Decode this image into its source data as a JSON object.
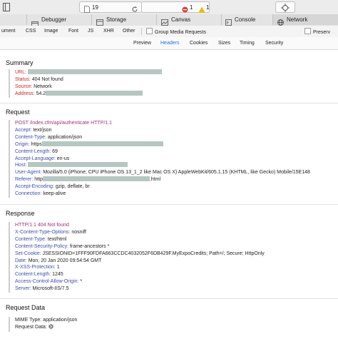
{
  "window": {
    "tab_count": "19",
    "error_count": "1",
    "warning_count": "1"
  },
  "panel_tabs": [
    {
      "label": "Debugger"
    },
    {
      "label": "Storage"
    },
    {
      "label": "Canvas"
    },
    {
      "label": "Console"
    },
    {
      "label": "Network"
    }
  ],
  "filter_bar": {
    "types": [
      "ument",
      "CSS",
      "Image",
      "Font",
      "JS",
      "XHR",
      "Other"
    ],
    "group_media_label": "Group Media Requests",
    "preserve_label": "Preserv"
  },
  "detail_tabs": [
    "Preview",
    "Headers",
    "Cookies",
    "Sizes",
    "Timing",
    "Security"
  ],
  "active_detail_tab": "Headers",
  "summary": {
    "title": "Summary",
    "url_key": "URL:",
    "status_key": "Status:",
    "status_val": "404 Not found",
    "source_key": "Source:",
    "source_val": "Network",
    "address_key": "Address:",
    "address_val": "54.2"
  },
  "request": {
    "title": "Request",
    "request_line": "POST /index.cfm/api/authenticate HTTP/1.1",
    "headers": [
      {
        "k": "Accept:",
        "v": "text/json"
      },
      {
        "k": "Content-Type:",
        "v": "application/json"
      },
      {
        "k": "Origin:",
        "v": "https"
      },
      {
        "k": "Content-Length:",
        "v": "69"
      },
      {
        "k": "Accept-Language:",
        "v": "en-us"
      },
      {
        "k": "Host:",
        "v": ""
      },
      {
        "k": "User-Agent:",
        "v": "Mozilla/5.0 (iPhone; CPU iPhone OS 13_1_2 like Mac OS X) AppleWebKit/605.1.15 (KHTML, like Gecko) Mobile/15E148"
      },
      {
        "k": "Referer:",
        "v": "http",
        "tail": ".html"
      },
      {
        "k": "Accept-Encoding:",
        "v": "gzip, deflate, br"
      },
      {
        "k": "Connection:",
        "v": "keep-alive"
      }
    ]
  },
  "response": {
    "title": "Response",
    "status_line": "HTTP/1.1 404 Not found",
    "headers": [
      {
        "k": "X-Content-Type-Options:",
        "v": "nosniff"
      },
      {
        "k": "Content-Type:",
        "v": "text/html"
      },
      {
        "k": "Content-Security-Policy:",
        "v": "frame-ancestors *"
      },
      {
        "k": "Set-Cookie:",
        "v": "JSESSIONID=1FFF90FDFA663CCDC4032052F6DB429F.MyExpoCredits; Path=/; Secure; HttpOnly"
      },
      {
        "k": "Date:",
        "v": "Mon, 20 Jan 2020 09:54:54 GMT"
      },
      {
        "k": "X-XSS-Protection:",
        "v": "1"
      },
      {
        "k": "Content-Length:",
        "v": "1245"
      },
      {
        "k": "Access-Control-Allow-Origin:",
        "v": "*"
      },
      {
        "k": "Server:",
        "v": "Microsoft-IIS/7.5"
      }
    ]
  },
  "request_data": {
    "title": "Request Data",
    "mime_key": "MIME Type:",
    "mime_val": "application/json",
    "data_key": "Request Data:"
  }
}
